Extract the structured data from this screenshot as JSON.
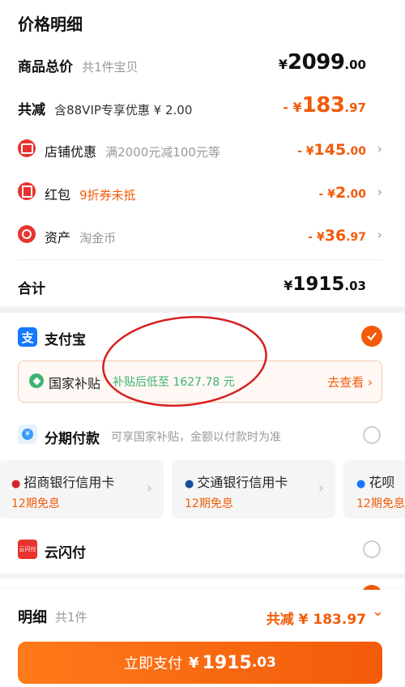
{
  "title": "价格明细",
  "goods": {
    "label": "商品总价",
    "sub": "共1件宝贝",
    "yen": "¥",
    "int": "2099",
    "dec": ".00"
  },
  "discount": {
    "label": "共减",
    "sub": "含88VIP专享优惠 ¥ 2.00",
    "prefix": "- ¥",
    "int": "183",
    "dec": ".97"
  },
  "shop": {
    "label": "店铺优惠",
    "sub": "满2000元减100元等",
    "prefix": "- ¥",
    "int": "145",
    "dec": ".00",
    "chev": "›"
  },
  "redpacket": {
    "label": "红包",
    "sub": "9折券未抵",
    "prefix": "- ¥",
    "int": "2",
    "dec": ".00",
    "chev": "›"
  },
  "asset": {
    "label": "资产",
    "sub": "淘金币",
    "prefix": "- ¥",
    "int": "36",
    "dec": ".97",
    "chev": "›"
  },
  "total": {
    "label": "合计",
    "yen": "¥",
    "int": "1915",
    "dec": ".03"
  },
  "alipay": {
    "label": "支付宝",
    "icon_char": "支"
  },
  "subsidy": {
    "label": "国家补贴",
    "desc": "补贴后低至 1627.78 元",
    "link": "去查看 ›"
  },
  "installment": {
    "label": "分期付款",
    "desc": "可享国家补贴，金额以付款时为准"
  },
  "cards": [
    {
      "name": "招商银行信用卡",
      "plan": "12期免息"
    },
    {
      "name": "交通银行信用卡",
      "plan": "12期免息"
    },
    {
      "name": "花呗",
      "plan": "12期免息"
    }
  ],
  "unionpay": {
    "label": "云闪付",
    "icon_text": "云闪付"
  },
  "footer": {
    "label": "明细",
    "count": "共1件",
    "discount": "共减 ¥ 183.97",
    "expand": "⌄"
  },
  "pay_button": {
    "label": "立即支付",
    "yen": "¥",
    "int": "1915",
    "dec": ".03"
  },
  "colors": {
    "accent": "#f25b0a",
    "red": "#e8332e",
    "alipay": "#1677ff",
    "green": "#3cb371"
  }
}
